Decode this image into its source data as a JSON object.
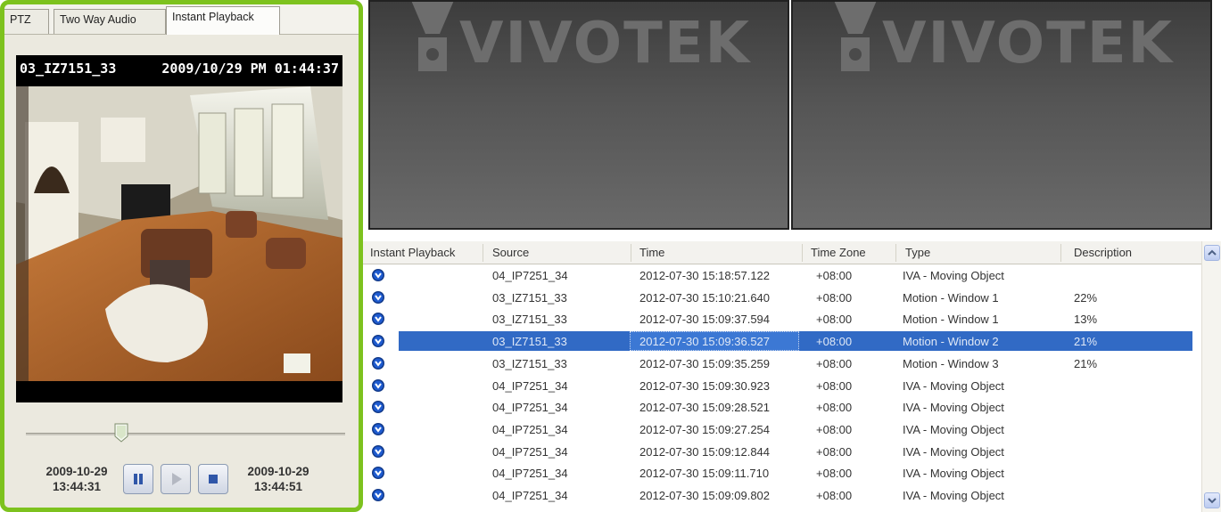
{
  "tabs": [
    {
      "label": "PTZ"
    },
    {
      "label": "Two Way Audio"
    },
    {
      "label": "Instant Playback"
    }
  ],
  "active_tab": "Instant Playback",
  "playback": {
    "camera_name": "03_IZ7151_33",
    "overlay_time": "2009/10/29 PM 01:44:37",
    "start_date": "2009-10-29",
    "start_time": "13:44:31",
    "end_date": "2009-10-29",
    "end_time": "13:44:51",
    "slider_position": 0.3,
    "buttons": {
      "pause": "pause-icon",
      "play": "play-icon",
      "stop": "stop-icon"
    }
  },
  "tiles": [
    {
      "logo": "VIVOTEK"
    },
    {
      "logo": "VIVOTEK"
    }
  ],
  "table": {
    "headers": {
      "instant_playback": "Instant Playback",
      "source": "Source",
      "time": "Time",
      "time_zone": "Time Zone",
      "type": "Type",
      "description": "Description"
    },
    "rows": [
      {
        "source": "04_IP7251_34",
        "time": "2012-07-30 15:18:57.122",
        "tz": "+08:00",
        "type": "IVA - Moving Object",
        "desc": ""
      },
      {
        "source": "03_IZ7151_33",
        "time": "2012-07-30 15:10:21.640",
        "tz": "+08:00",
        "type": "Motion - Window 1",
        "desc": "22%"
      },
      {
        "source": "03_IZ7151_33",
        "time": "2012-07-30 15:09:37.594",
        "tz": "+08:00",
        "type": "Motion - Window 1",
        "desc": "13%"
      },
      {
        "source": "03_IZ7151_33",
        "time": "2012-07-30 15:09:36.527",
        "tz": "+08:00",
        "type": "Motion - Window 2",
        "desc": "21%",
        "selected": true
      },
      {
        "source": "03_IZ7151_33",
        "time": "2012-07-30 15:09:35.259",
        "tz": "+08:00",
        "type": "Motion - Window 3",
        "desc": "21%"
      },
      {
        "source": "04_IP7251_34",
        "time": "2012-07-30 15:09:30.923",
        "tz": "+08:00",
        "type": "IVA - Moving Object",
        "desc": ""
      },
      {
        "source": "04_IP7251_34",
        "time": "2012-07-30 15:09:28.521",
        "tz": "+08:00",
        "type": "IVA - Moving Object",
        "desc": ""
      },
      {
        "source": "04_IP7251_34",
        "time": "2012-07-30 15:09:27.254",
        "tz": "+08:00",
        "type": "IVA - Moving Object",
        "desc": ""
      },
      {
        "source": "04_IP7251_34",
        "time": "2012-07-30 15:09:12.844",
        "tz": "+08:00",
        "type": "IVA - Moving Object",
        "desc": ""
      },
      {
        "source": "04_IP7251_34",
        "time": "2012-07-30 15:09:11.710",
        "tz": "+08:00",
        "type": "IVA - Moving Object",
        "desc": ""
      },
      {
        "source": "04_IP7251_34",
        "time": "2012-07-30 15:09:09.802",
        "tz": "+08:00",
        "type": "IVA - Moving Object",
        "desc": ""
      }
    ]
  },
  "colors": {
    "panel_highlight": "#7dc21e",
    "selection": "#316ac5"
  }
}
